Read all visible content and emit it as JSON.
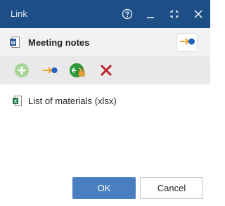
{
  "window": {
    "title": "Link",
    "controls": [
      "help-icon",
      "minimize-icon",
      "maximize-icon",
      "close-icon"
    ]
  },
  "document": {
    "icon": "word-document-icon",
    "title": "Meeting notes",
    "link_button_icon": "link-arrow-icon"
  },
  "toolbar": {
    "tools": [
      {
        "name": "add-icon",
        "color": "#9ccf8c",
        "enabled": false
      },
      {
        "name": "link-arrow-icon",
        "color": "#f0a020"
      },
      {
        "name": "linked-locked-icon",
        "color": "#2e9a3a"
      },
      {
        "name": "remove-icon",
        "color": "#c0202a"
      }
    ]
  },
  "links": [
    {
      "icon": "excel-document-icon",
      "label": "List of materials (xlsx)"
    }
  ],
  "buttons": {
    "ok_label": "OK",
    "cancel_label": "Cancel"
  },
  "colors": {
    "titlebar": "#1d4e86",
    "accent": "#4a7fbf"
  }
}
